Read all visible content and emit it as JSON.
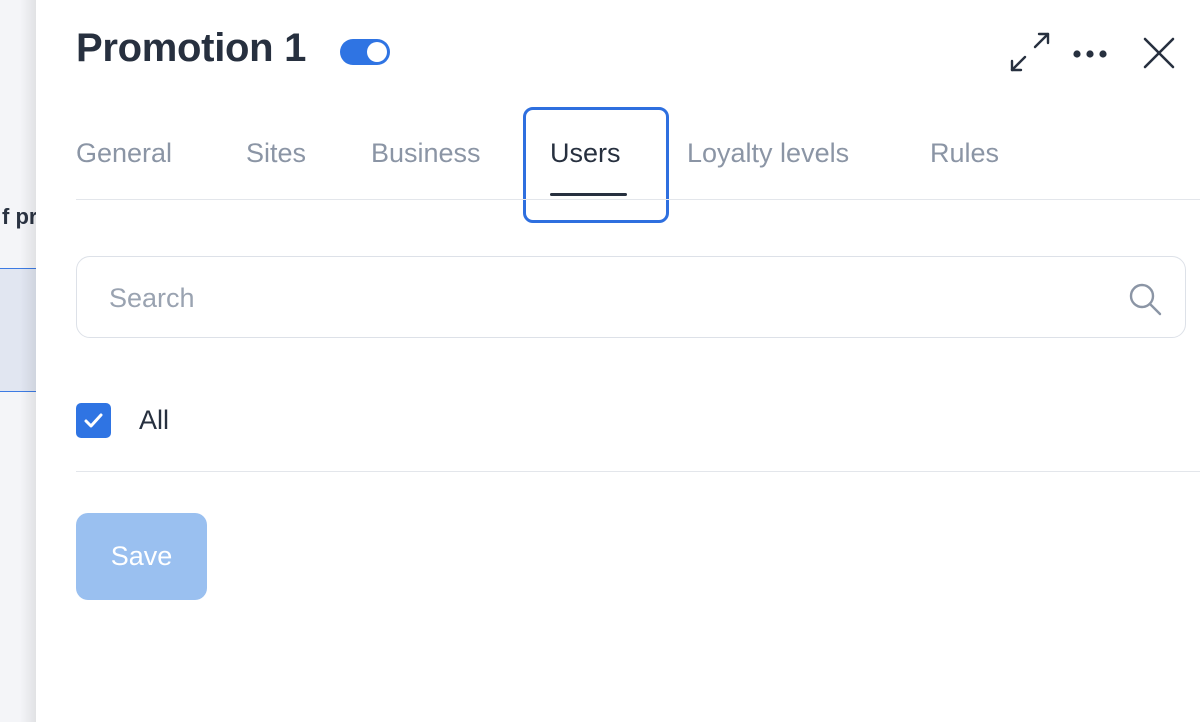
{
  "background": {
    "partial_text": "f pr"
  },
  "drawer": {
    "title": "Promotion 1",
    "active_toggle": {
      "on": true,
      "color": "#2f74e3"
    },
    "header_icons": [
      "expand-icon",
      "more-icon",
      "close-icon"
    ]
  },
  "tabs": [
    {
      "label": "General",
      "active": false
    },
    {
      "label": "Sites",
      "active": false
    },
    {
      "label": "Business",
      "active": false
    },
    {
      "label": "Users",
      "active": true
    },
    {
      "label": "Loyalty levels",
      "active": false
    },
    {
      "label": "Rules",
      "active": false
    }
  ],
  "search": {
    "placeholder": "Search",
    "value": "",
    "icon": "search-icon"
  },
  "users_filter": {
    "all_label": "All",
    "all_checked": true
  },
  "actions": {
    "save_label": "Save",
    "save_enabled": false
  },
  "colors": {
    "accent": "#2f74e3",
    "focus_ring": "#2e6fdf",
    "text_primary": "#27303f",
    "text_muted": "#8b95a5",
    "disabled_button": "#9ac0f0"
  }
}
